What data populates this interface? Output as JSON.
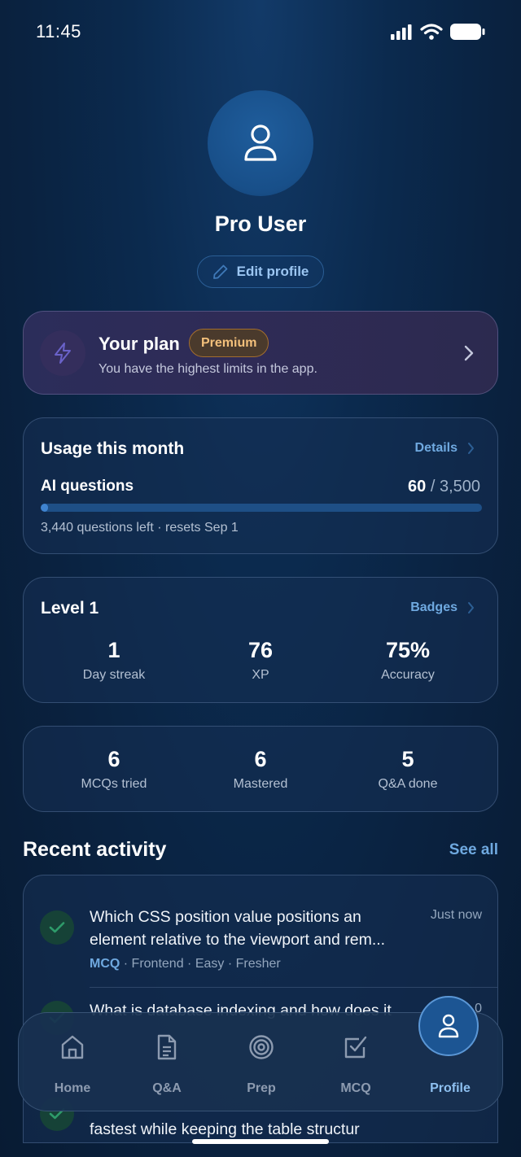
{
  "status_bar": {
    "time": "11:45"
  },
  "profile": {
    "name": "Pro User",
    "edit_label": "Edit profile"
  },
  "plan": {
    "title": "Your plan",
    "badge": "Premium",
    "subtitle": "You have the highest limits in the app.",
    "badge_color": "#f3c07b"
  },
  "usage": {
    "title": "Usage this month",
    "link": "Details",
    "label": "AI questions",
    "used": "60",
    "total": "/ 3,500",
    "progress_fraction": 0.017,
    "note": "3,440 questions left · resets Sep 1"
  },
  "level": {
    "title": "Level 1",
    "link": "Badges",
    "stats": [
      {
        "value": "1",
        "label": "Day streak"
      },
      {
        "value": "76",
        "label": "XP"
      },
      {
        "value": "75%",
        "label": "Accuracy"
      }
    ]
  },
  "totals": {
    "stats": [
      {
        "value": "6",
        "label": "MCQs tried"
      },
      {
        "value": "6",
        "label": "Mastered"
      },
      {
        "value": "5",
        "label": "Q&A done"
      }
    ]
  },
  "activity": {
    "title": "Recent activity",
    "see_all": "See all",
    "items": [
      {
        "question": "Which CSS position value positions an element relative to the viewport and rem...",
        "time": "Just now",
        "tag": "MCQ",
        "topic": "· Frontend",
        "difficulty": "· Easy",
        "level": "· Fresher"
      },
      {
        "question": "What is database indexing and how does it",
        "time": "0"
      },
      {
        "question": "fastest while keeping the table structur"
      }
    ]
  },
  "tabs": [
    {
      "label": "Home",
      "icon": "home-icon"
    },
    {
      "label": "Q&A",
      "icon": "document-icon"
    },
    {
      "label": "Prep",
      "icon": "target-icon"
    },
    {
      "label": "MCQ",
      "icon": "checkbox-icon"
    },
    {
      "label": "Profile",
      "icon": "user-icon",
      "active": true
    }
  ],
  "colors": {
    "accent": "#6fa9e0",
    "success": "#2e9b6a",
    "background": "#0a2240"
  }
}
